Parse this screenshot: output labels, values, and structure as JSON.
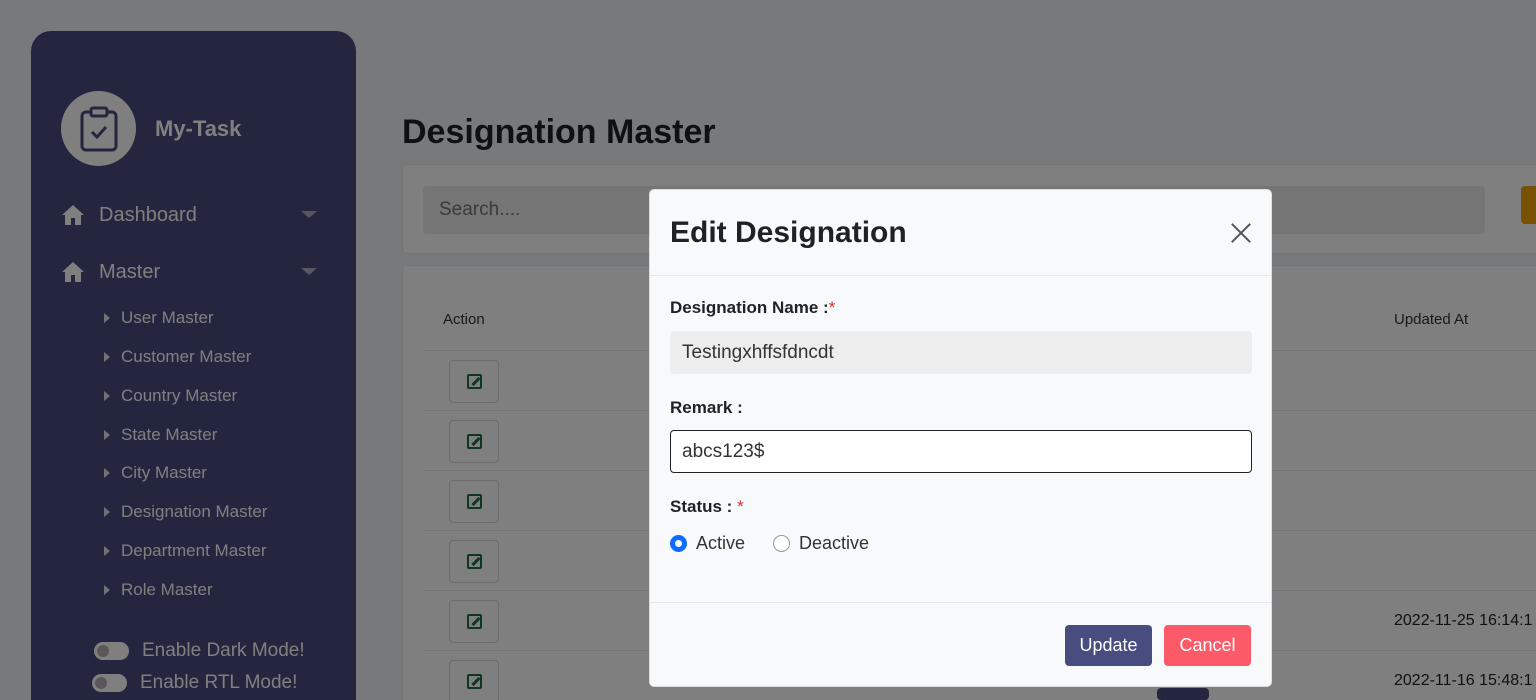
{
  "app": {
    "name": "My-Task"
  },
  "sidebar": {
    "nav": [
      {
        "label": "Dashboard"
      },
      {
        "label": "Master"
      }
    ],
    "sub_items": [
      {
        "label": "User Master"
      },
      {
        "label": "Customer Master"
      },
      {
        "label": "Country Master"
      },
      {
        "label": "State Master"
      },
      {
        "label": "City Master"
      },
      {
        "label": "Designation Master"
      },
      {
        "label": "Department Master"
      },
      {
        "label": "Role Master"
      }
    ],
    "toggles": [
      {
        "label": "Enable Dark Mode!"
      },
      {
        "label": "Enable RTL Mode!"
      }
    ]
  },
  "main": {
    "title": "Designation Master",
    "search_placeholder": "Search....",
    "table": {
      "headers": {
        "action": "Action",
        "updated_at": "Updated At"
      },
      "rows": [
        {
          "updated_at": ""
        },
        {
          "updated_at": ""
        },
        {
          "updated_at": ""
        },
        {
          "updated_at": ""
        },
        {
          "updated_at": "2022-11-25 16:14:1"
        },
        {
          "updated_at": "2022-11-16 15:48:1"
        }
      ]
    }
  },
  "modal": {
    "title": "Edit Designation",
    "name_label": "Designation Name :",
    "required_mark": "*",
    "name_value": "Testingxhffsfdncdt",
    "remark_label": "Remark :",
    "remark_value": "abcs123$",
    "status_label": "Status :",
    "status_options": [
      {
        "label": "Active",
        "selected": true
      },
      {
        "label": "Deactive",
        "selected": false
      }
    ],
    "update_label": "Update",
    "cancel_label": "Cancel"
  },
  "colors": {
    "sidebar": "#484c7f",
    "primary": "#484c7f",
    "danger": "#fc5a69",
    "radio": "#0d6efd"
  }
}
